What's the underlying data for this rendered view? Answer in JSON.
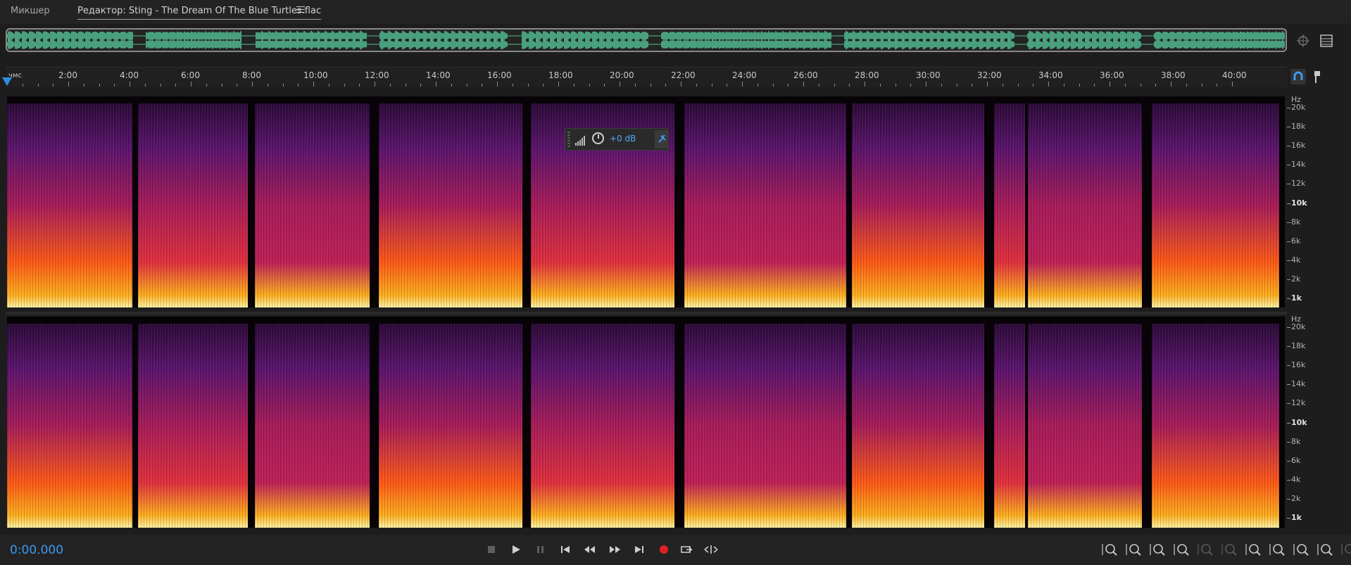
{
  "tabs": {
    "mixer": "Микшер",
    "editor": "Редактор: Sting - The Dream Of The Blue Turtles.flac"
  },
  "ruler": {
    "units_label": "чмс",
    "ticks": [
      "2:00",
      "4:00",
      "6:00",
      "8:00",
      "10:00",
      "12:00",
      "14:00",
      "16:00",
      "18:00",
      "20:00",
      "22:00",
      "24:00",
      "26:00",
      "28:00",
      "30:00",
      "32:00",
      "34:00",
      "36:00",
      "38:00",
      "40:00"
    ]
  },
  "frequency_axis": {
    "unit": "Hz",
    "labels": [
      "20k",
      "18k",
      "16k",
      "14k",
      "12k",
      "10k",
      "8k",
      "6k",
      "4k",
      "2k",
      "1k"
    ]
  },
  "hud": {
    "gain_label": "+0 dB"
  },
  "transport": {
    "current_time": "0:00.000"
  },
  "colors": {
    "accent": "#3a9af0",
    "record": "#e02020",
    "overview_wave": "#5fe3b0"
  },
  "icons": {
    "overview_right": [
      "zoom-crosshair-icon",
      "panel-list-icon"
    ],
    "ruler_right": [
      "snap-magnet-icon",
      "marker-pin-icon"
    ],
    "transport": [
      "stop-icon",
      "play-icon",
      "pause-icon",
      "go-to-start-icon",
      "rewind-icon",
      "fast-forward-icon",
      "go-to-end-icon",
      "record-icon",
      "loop-icon",
      "skip-selection-icon"
    ],
    "zoom": [
      "zoom-in-amplitude-icon",
      "zoom-out-amplitude-icon",
      "zoom-in-time-icon",
      "zoom-out-time-icon",
      "zoom-out-full-icon",
      "zoom-in-selection-icon",
      "zoom-out-left-icon",
      "zoom-out-right-icon",
      "zoom-to-selection-icon",
      "zoom-reset-icon",
      "zoom-in-frequency-icon"
    ]
  }
}
